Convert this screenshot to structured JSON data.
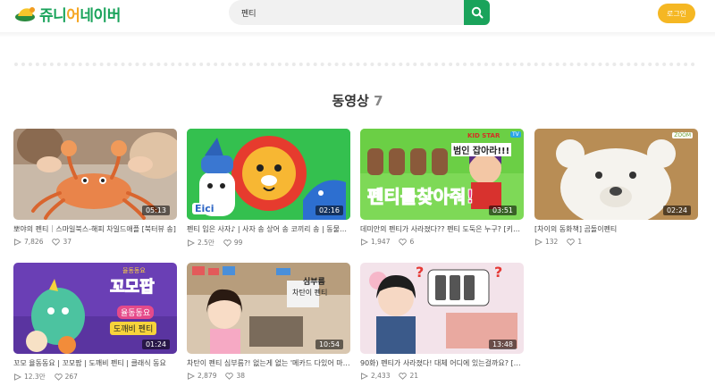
{
  "header": {
    "logo_text_part1": "쥬니",
    "logo_text_part2": "어",
    "logo_text_part3": "네이버",
    "search_value": "펜티",
    "search_icon": "search-icon",
    "login_label": "로그인"
  },
  "section": {
    "title": "동영상",
    "count": "7"
  },
  "videos": [
    {
      "title": "뽀야의 펜티｜스마일북스-해피 차일드애플 [북터뷰 송]",
      "views": "7,826",
      "likes": "37",
      "duration": "05:13"
    },
    {
      "title": "펜티 입은 사자♪ | 사자 송 상어 송 코끼리 송 | 동물동요 ...",
      "views": "2.5만",
      "likes": "99",
      "duration": "02:16"
    },
    {
      "title": "데미안의 펜티가 사라졌다?? 펜티 도둑은 누구? [키즈...",
      "views": "1,947",
      "likes": "6",
      "duration": "03:51"
    },
    {
      "title": "[차이의 동화책] 곰돌이펜티",
      "views": "132",
      "likes": "1",
      "duration": "02:24"
    },
    {
      "title": "꼬모 율동동요 | 꼬모팝 | 도깨비 펜티 | 클래식 동요",
      "views": "12.3만",
      "likes": "267",
      "duration": "01:24"
    },
    {
      "title": "차탄이 펜티 심부름?! 없는게 없는 '메카드 다있어 마트'...",
      "views": "2,879",
      "likes": "38",
      "duration": "10:54"
    },
    {
      "title": "90화) 펜티가 사라졌다! 대체 어디에 있는걸까요? [멈마...",
      "views": "2,433",
      "likes": "21",
      "duration": "13:48"
    }
  ],
  "thumb_text": {
    "t2_logo": "Eici",
    "t3_banner": "KID STAR",
    "t3_tv": "TV",
    "t3_headline": "범인 잡아라!!!",
    "t3_big": "펜티를찾아줘!",
    "t4_brand": "ZOOM",
    "t5_top": "율동동요",
    "t5_title": "꼬모팝",
    "t5_sub1": "율동동요",
    "t5_sub2": "도깨비 펜티",
    "t6_line1": "심부름",
    "t6_line2": "차탄이 펜티"
  },
  "colors": {
    "accent_green": "#1aa35b",
    "login_yellow": "#f5b723"
  }
}
